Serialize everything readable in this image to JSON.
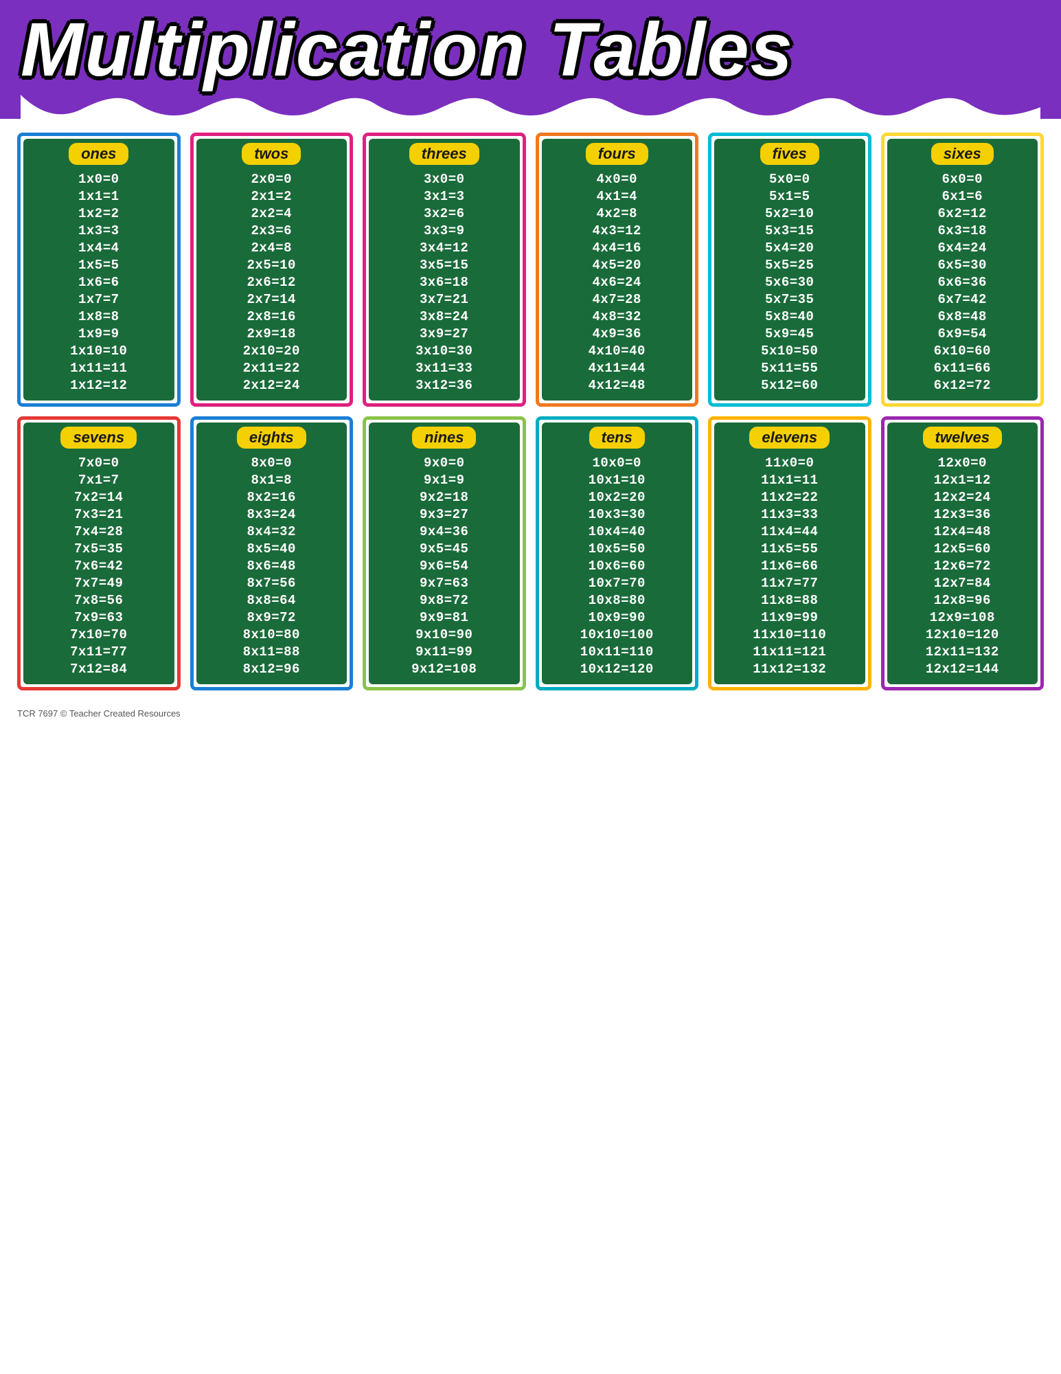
{
  "header": {
    "title": "Multiplication Tables",
    "bg_color": "#7b2fbe"
  },
  "tables": [
    {
      "label": "ones",
      "border": "border-blue",
      "rows": [
        "1x0=0",
        "1x1=1",
        "1x2=2",
        "1x3=3",
        "1x4=4",
        "1x5=5",
        "1x6=6",
        "1x7=7",
        "1x8=8",
        "1x9=9",
        "1x10=10",
        "1x11=11",
        "1x12=12"
      ]
    },
    {
      "label": "twos",
      "border": "border-pink",
      "rows": [
        "2x0=0",
        "2x1=2",
        "2x2=4",
        "2x3=6",
        "2x4=8",
        "2x5=10",
        "2x6=12",
        "2x7=14",
        "2x8=16",
        "2x9=18",
        "2x10=20",
        "2x11=22",
        "2x12=24"
      ]
    },
    {
      "label": "threes",
      "border": "border-pink",
      "rows": [
        "3x0=0",
        "3x1=3",
        "3x2=6",
        "3x3=9",
        "3x4=12",
        "3x5=15",
        "3x6=18",
        "3x7=21",
        "3x8=24",
        "3x9=27",
        "3x10=30",
        "3x11=33",
        "3x12=36"
      ]
    },
    {
      "label": "fours",
      "border": "border-orange",
      "rows": [
        "4x0=0",
        "4x1=4",
        "4x2=8",
        "4x3=12",
        "4x4=16",
        "4x5=20",
        "4x6=24",
        "4x7=28",
        "4x8=32",
        "4x9=36",
        "4x10=40",
        "4x11=44",
        "4x12=48"
      ]
    },
    {
      "label": "fives",
      "border": "border-teal",
      "rows": [
        "5x0=0",
        "5x1=5",
        "5x2=10",
        "5x3=15",
        "5x4=20",
        "5x5=25",
        "5x6=30",
        "5x7=35",
        "5x8=40",
        "5x9=45",
        "5x10=50",
        "5x11=55",
        "5x12=60"
      ]
    },
    {
      "label": "sixes",
      "border": "border-yellow",
      "rows": [
        "6x0=0",
        "6x1=6",
        "6x2=12",
        "6x3=18",
        "6x4=24",
        "6x5=30",
        "6x6=36",
        "6x7=42",
        "6x8=48",
        "6x9=54",
        "6x10=60",
        "6x11=66",
        "6x12=72"
      ]
    },
    {
      "label": "sevens",
      "border": "border-red",
      "rows": [
        "7x0=0",
        "7x1=7",
        "7x2=14",
        "7x3=21",
        "7x4=28",
        "7x5=35",
        "7x6=42",
        "7x7=49",
        "7x8=56",
        "7x9=63",
        "7x10=70",
        "7x11=77",
        "7x12=84"
      ]
    },
    {
      "label": "eights",
      "border": "border-blue",
      "rows": [
        "8x0=0",
        "8x1=8",
        "8x2=16",
        "8x3=24",
        "8x4=32",
        "8x5=40",
        "8x6=48",
        "8x7=56",
        "8x8=64",
        "8x9=72",
        "8x10=80",
        "8x11=88",
        "8x12=96"
      ]
    },
    {
      "label": "nines",
      "border": "border-lime",
      "rows": [
        "9x0=0",
        "9x1=9",
        "9x2=18",
        "9x3=27",
        "9x4=36",
        "9x5=45",
        "9x6=54",
        "9x7=63",
        "9x8=72",
        "9x9=81",
        "9x10=90",
        "9x11=99",
        "9x12=108"
      ]
    },
    {
      "label": "tens",
      "border": "border-cyan",
      "rows": [
        "10x0=0",
        "10x1=10",
        "10x2=20",
        "10x3=30",
        "10x4=40",
        "10x5=50",
        "10x6=60",
        "10x7=70",
        "10x8=80",
        "10x9=90",
        "10x10=100",
        "10x11=110",
        "10x12=120"
      ]
    },
    {
      "label": "elevens",
      "border": "border-amber",
      "rows": [
        "11x0=0",
        "11x1=11",
        "11x2=22",
        "11x3=33",
        "11x4=44",
        "11x5=55",
        "11x6=66",
        "11x7=77",
        "11x8=88",
        "11x9=99",
        "11x10=110",
        "11x11=121",
        "11x12=132"
      ]
    },
    {
      "label": "twelves",
      "border": "border-purple",
      "rows": [
        "12x0=0",
        "12x1=12",
        "12x2=24",
        "12x3=36",
        "12x4=48",
        "12x5=60",
        "12x6=72",
        "12x7=84",
        "12x8=96",
        "12x9=108",
        "12x10=120",
        "12x11=132",
        "12x12=144"
      ]
    }
  ],
  "footer": "TCR 7697  © Teacher Created Resources"
}
